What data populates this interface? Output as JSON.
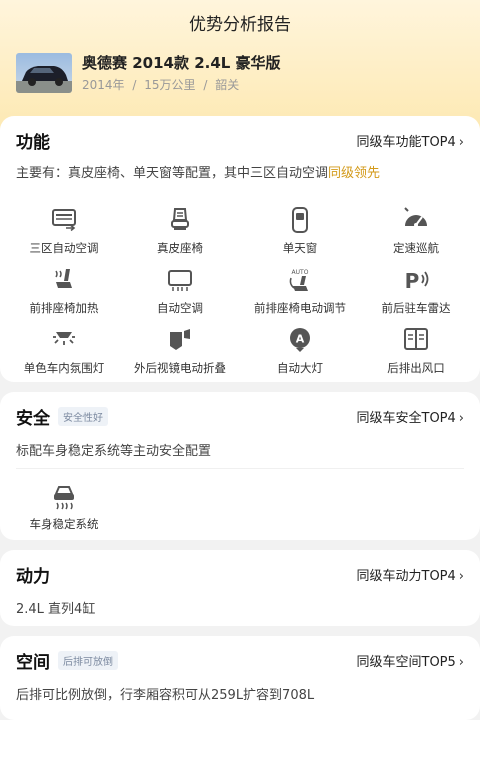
{
  "page": {
    "title": "优势分析报告"
  },
  "car": {
    "name": "奥德赛 2014款 2.4L 豪华版",
    "year": "2014年",
    "sep1": "/",
    "mileage": "15万公里",
    "sep2": "/",
    "city": "韶关"
  },
  "function_section": {
    "title": "功能",
    "rank_label": "同级车功能TOP4",
    "desc_main": "主要有：真皮座椅、单天窗等配置，其中三区自动空调",
    "desc_highlight": "同级领先",
    "features": [
      {
        "label": "三区自动空调",
        "icon": "climate-zone-icon"
      },
      {
        "label": "真皮座椅",
        "icon": "leather-seat-icon"
      },
      {
        "label": "单天窗",
        "icon": "sunroof-icon"
      },
      {
        "label": "定速巡航",
        "icon": "cruise-control-icon"
      },
      {
        "label": "前排座椅加热",
        "icon": "seat-heating-icon"
      },
      {
        "label": "自动空调",
        "icon": "auto-ac-icon"
      },
      {
        "label": "前排座椅电动调节",
        "icon": "power-seat-icon"
      },
      {
        "label": "前后驻车雷达",
        "icon": "parking-radar-icon"
      },
      {
        "label": "单色车内氛围灯",
        "icon": "ambient-light-icon"
      },
      {
        "label": "外后视镜电动折叠",
        "icon": "mirror-fold-icon"
      },
      {
        "label": "自动大灯",
        "icon": "auto-headlight-icon"
      },
      {
        "label": "后排出风口",
        "icon": "rear-vent-icon"
      }
    ]
  },
  "safety_section": {
    "title": "安全",
    "tag": "安全性好",
    "rank_label": "同级车安全TOP4",
    "desc": "标配车身稳定系统等主动安全配置",
    "features": [
      {
        "label": "车身稳定系统",
        "icon": "stability-control-icon"
      }
    ]
  },
  "power_section": {
    "title": "动力",
    "rank_label": "同级车动力TOP4",
    "desc": "2.4L 直列4缸"
  },
  "space_section": {
    "title": "空间",
    "tag": "后排可放倒",
    "rank_label": "同级车空间TOP5",
    "desc": "后排可比例放倒，行李厢容积可从259L扩容到708L"
  },
  "chevron": "›"
}
